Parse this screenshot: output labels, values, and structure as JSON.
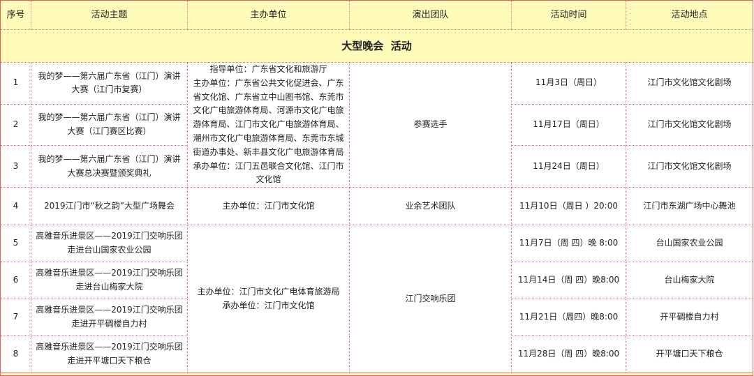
{
  "headers": [
    "序号",
    "活动主题",
    "主办单位",
    "演出团队",
    "活动时间",
    "活动地点"
  ],
  "section_title": "大型晚会  活动",
  "groups": {
    "g1_org": [
      "指导单位：广东省文化和旅游厅",
      "主办单位：广东省公共文化促进会、广东省文化馆、广东省立中山图书馆、东莞市文化广电旅游体育局、河源市文化广电旅游体育局、江门市文化广电旅游体育局、潮州市文化广电旅游体育局、东莞市东城街道办事处、新丰县文化广电旅游体育局",
      "承办单位：江门五邑联合文化馆、江门市文化馆"
    ],
    "g1_team": "参赛选手",
    "g3_org": [
      "主办单位：江门市文化广电体育旅游局",
      "承办单位：江门市文化馆"
    ],
    "g3_team": "江门交响乐团"
  },
  "rows": [
    {
      "no": "1",
      "topic": "我的梦——第六届广东省（江门）演讲大赛（江门市复赛）",
      "time": "11月3日（周日）",
      "place": "江门市文化馆文化剧场"
    },
    {
      "no": "2",
      "topic": "我的梦——第六届广东省（江门）演讲大赛（江门赛区比赛）",
      "time": "11月17日（周日）",
      "place": "江门市文化馆文化剧场"
    },
    {
      "no": "3",
      "topic": "我的梦——第六届广东省（江门）演讲大赛总决赛暨颁奖典礼",
      "time": "11月24日（周日）",
      "place": "江门市文化馆文化剧场"
    },
    {
      "no": "4",
      "topic": "2019江门市“秋之韵”大型广场舞会",
      "org": "主办单位：江门市文化馆",
      "team": "业余艺术团队",
      "time": "11月10日（周日 ）20:00",
      "place": "江门市东湖广场中心舞池"
    },
    {
      "no": "5",
      "topic": "高雅音乐进景区——2019江门交响乐团走进台山国家农业公园",
      "time": "11月7日（周 四）晚 8:00",
      "place": "台山国家农业公园"
    },
    {
      "no": "6",
      "topic": "高雅音乐进景区——2019江门交响乐团走进台山梅家大院",
      "time": "11月14日（周 四）晚8:00",
      "place": "台山梅家大院"
    },
    {
      "no": "7",
      "topic": "高雅音乐进景区——2019江门交响乐团走进开平碉楼自力村",
      "time": "11月21日（周四）晚8:00",
      "place": "开平碉楼自力村"
    },
    {
      "no": "8",
      "topic": "高雅音乐进景区——2019江门交响乐团走进开平塘口天下粮仓",
      "time": "11月28日（周 四）晚8:00",
      "place": "开平塘口天下粮仓"
    }
  ]
}
